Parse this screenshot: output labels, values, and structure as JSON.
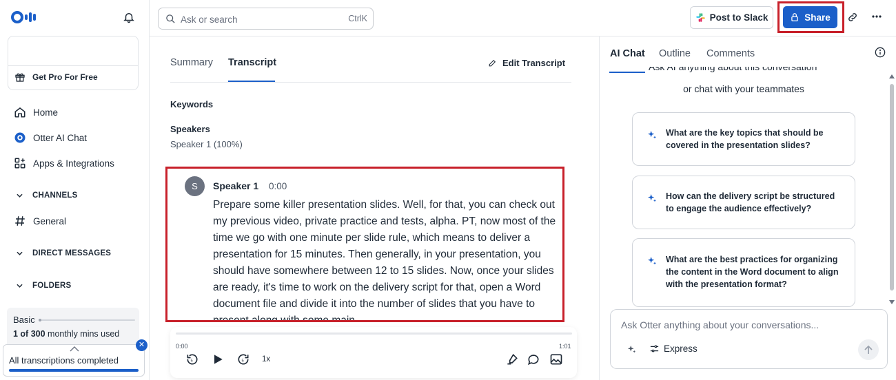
{
  "sidebar": {
    "promo_label": "Get Pro For Free",
    "nav": [
      {
        "label": "Home"
      },
      {
        "label": "Otter AI Chat"
      },
      {
        "label": "Apps & Integrations"
      }
    ],
    "channels_label": "CHANNELS",
    "channel_general": "General",
    "direct_messages_label": "DIRECT MESSAGES",
    "folders_label": "FOLDERS",
    "plan": {
      "name": "Basic",
      "usage_count": "1 of 300",
      "usage_suffix": "monthly mins used"
    },
    "toast": {
      "text": "All transcriptions completed"
    }
  },
  "topbar": {
    "search_placeholder": "Ask or search",
    "search_shortcut": "CtrlK",
    "slack_label": "Post to Slack",
    "share_label": "Share"
  },
  "main": {
    "tabs": [
      {
        "label": "Summary",
        "active": false
      },
      {
        "label": "Transcript",
        "active": true
      }
    ],
    "edit_label": "Edit Transcript",
    "keywords_label": "Keywords",
    "speakers_label": "Speakers",
    "speaker_summary": "Speaker 1 (100%)",
    "transcript": {
      "avatar_initial": "S",
      "speaker": "Speaker 1",
      "time": "0:00",
      "text": "Prepare some killer presentation slides. Well, for that, you can check out my previous video, private practice and tests, alpha. PT, now most of the time we go with one minute per slide rule, which means to deliver a presentation for 15 minutes. Then generally, in your presentation, you should have somewhere between 12 to 15 slides. Now, once your slides are ready, it's time to work on the delivery script for that, open a Word document file and divide it into the number of slides that you have to present along with some main"
    },
    "player": {
      "current_time": "0:00",
      "duration": "1:01",
      "speed": "1x"
    }
  },
  "right_panel": {
    "tabs": [
      {
        "label": "AI Chat",
        "active": true
      },
      {
        "label": "Outline",
        "active": false
      },
      {
        "label": "Comments",
        "active": false
      }
    ],
    "clipped_heading": "Ask AI anything about this conversation",
    "subtitle": "or chat with your teammates",
    "suggestions": [
      "What are the key topics that should be covered in the presentation slides?",
      "How can the delivery script be structured to engage the audience effectively?",
      "What are the best practices for organizing the content in the Word document to align with the presentation format?"
    ],
    "ask_placeholder": "Ask Otter anything about your conversations...",
    "express_label": "Express"
  },
  "colors": {
    "accent": "#1b5fc9",
    "highlight": "#c8202a"
  }
}
